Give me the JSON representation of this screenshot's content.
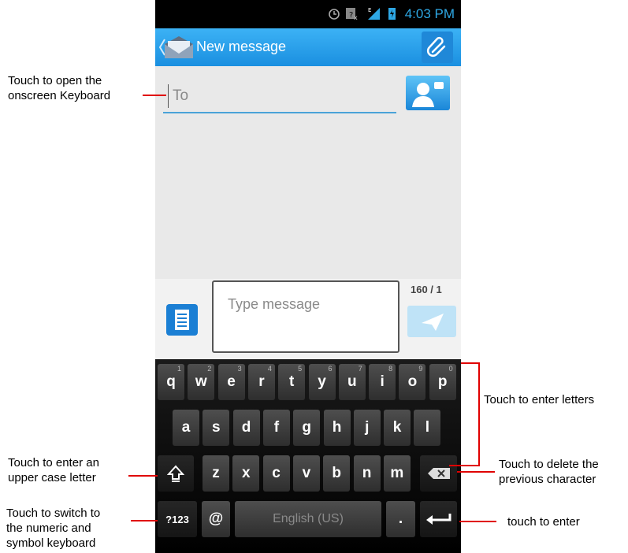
{
  "status_bar": {
    "time": "4:03 PM"
  },
  "action_bar": {
    "title": "New message"
  },
  "compose": {
    "to_placeholder": "To",
    "message_placeholder": "Type message",
    "char_counter": "160 / 1"
  },
  "keyboard": {
    "row1": [
      {
        "key": "q",
        "hint": "1"
      },
      {
        "key": "w",
        "hint": "2"
      },
      {
        "key": "e",
        "hint": "3"
      },
      {
        "key": "r",
        "hint": "4"
      },
      {
        "key": "t",
        "hint": "5"
      },
      {
        "key": "y",
        "hint": "6"
      },
      {
        "key": "u",
        "hint": "7"
      },
      {
        "key": "i",
        "hint": "8"
      },
      {
        "key": "o",
        "hint": "9"
      },
      {
        "key": "p",
        "hint": "0"
      }
    ],
    "row2": [
      "a",
      "s",
      "d",
      "f",
      "g",
      "h",
      "j",
      "k",
      "l"
    ],
    "row3": [
      "z",
      "x",
      "c",
      "v",
      "b",
      "n",
      "m"
    ],
    "symbols_label": "?123",
    "at_label": "@",
    "space_label": "English (US)",
    "period_label": "."
  },
  "callouts": {
    "open_keyboard": [
      "Touch to open the",
      "onscreen Keyboard"
    ],
    "enter_letters": "Touch to enter letters",
    "uppercase": [
      "Touch to enter an",
      "upper case letter"
    ],
    "delete": [
      "Touch to delete the",
      "previous character"
    ],
    "numeric": [
      "Touch to switch to",
      "the numeric and",
      "symbol keyboard"
    ],
    "enter": "touch to enter"
  },
  "colors": {
    "accent": "#2ea8e5",
    "callout_line": "#e00000",
    "action_bar": "#1a8fe0"
  },
  "icons": [
    "alarm-icon",
    "no-sim-icon",
    "signal-icon",
    "battery-icon",
    "back-icon",
    "mail-icon",
    "paperclip-icon",
    "contact-icon",
    "template-icon",
    "send-icon",
    "shift-icon",
    "backspace-icon",
    "enter-icon"
  ]
}
